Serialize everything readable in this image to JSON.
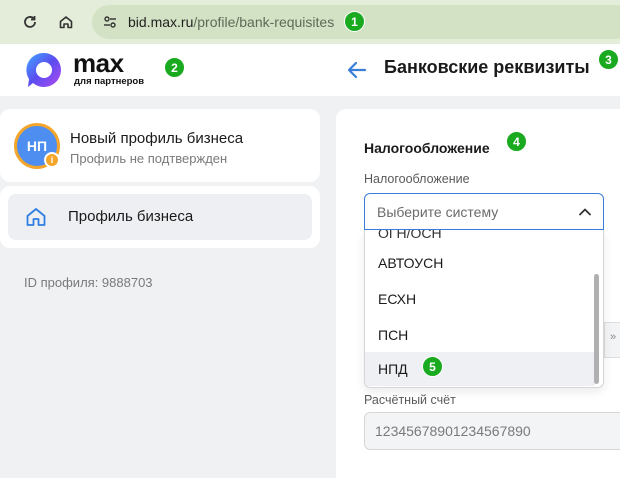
{
  "browser": {
    "url_host": "bid.max.ru",
    "url_path": "/profile/bank-requisites"
  },
  "badges": [
    "1",
    "2",
    "3",
    "4",
    "5"
  ],
  "header": {
    "logo_text": "max",
    "logo_sub": "для партнеров",
    "page_title": "Банковские реквизиты"
  },
  "sidebar": {
    "avatar_initials": "НП",
    "avatar_badge": "i",
    "profile_name": "Новый профиль бизнеса",
    "profile_status": "Профиль не подтвержден",
    "nav_item_label": "Профиль бизнеса",
    "profile_id": "ID профиля: 9888703"
  },
  "main": {
    "section_title": "Налогообложение",
    "field_label": "Налогообложение",
    "select_placeholder": "Выберите систему",
    "options": [
      "ОГН/ОСН",
      "АВТОУСН",
      "ЕСХН",
      "ПСН",
      "НПД"
    ],
    "hidden_input_fragment": "»",
    "account_label": "Расчётный счёт",
    "account_value": "12345678901234567890"
  },
  "colors": {
    "accent": "#3b7ed8",
    "badge": "#1aaa1f",
    "avatar": "#4d8ef0",
    "avatar_ring": "#f4a52c"
  }
}
